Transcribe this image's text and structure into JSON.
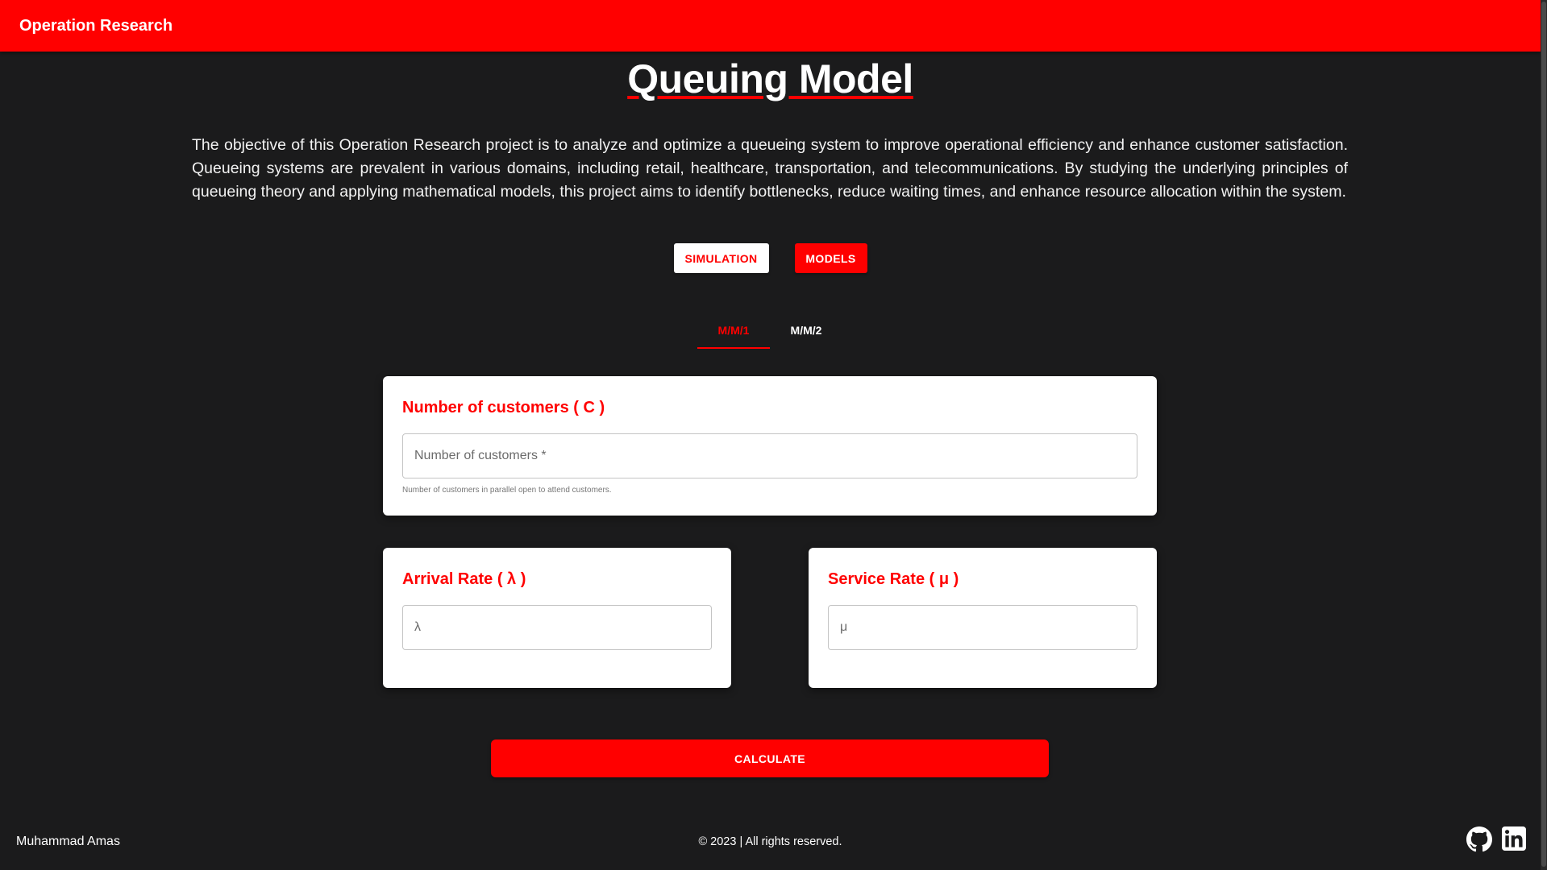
{
  "appbar": {
    "title": "Operation Research"
  },
  "page": {
    "title": "Queuing Model",
    "description": "The objective of this Operation Research project is to analyze and optimize a queueing system to improve operational efficiency and enhance customer satisfaction. Queueing systems are prevalent in various domains, including retail, healthcare, transportation, and telecommunications. By studying the underlying principles of queueing theory and applying mathematical models, this project aims to identify bottlenecks, reduce waiting times, and enhance resource allocation within the system."
  },
  "mode_buttons": {
    "simulation": "SIMULATION",
    "models": "MODELS"
  },
  "tabs": [
    {
      "label": "M/M/1",
      "active": true
    },
    {
      "label": "M/M/2",
      "active": false
    }
  ],
  "customers_card": {
    "title": "Number of customers ( C )",
    "placeholder": "Number of customers *",
    "helper": "Number of customers in parallel open to attend customers."
  },
  "arrival_card": {
    "title": "Arrival Rate ( λ )",
    "placeholder": "λ"
  },
  "service_card": {
    "title": "Service Rate ( μ )",
    "placeholder": "μ"
  },
  "calculate_label": "CALCULATE",
  "footer": {
    "name": "Muhammad Amas",
    "copyright": "© 2023 | All rights reserved.",
    "icons": [
      "github-icon",
      "linkedin-icon"
    ]
  },
  "colors": {
    "accent": "#ff0000",
    "background": "#1b1b1c",
    "card": "#ffffff"
  }
}
